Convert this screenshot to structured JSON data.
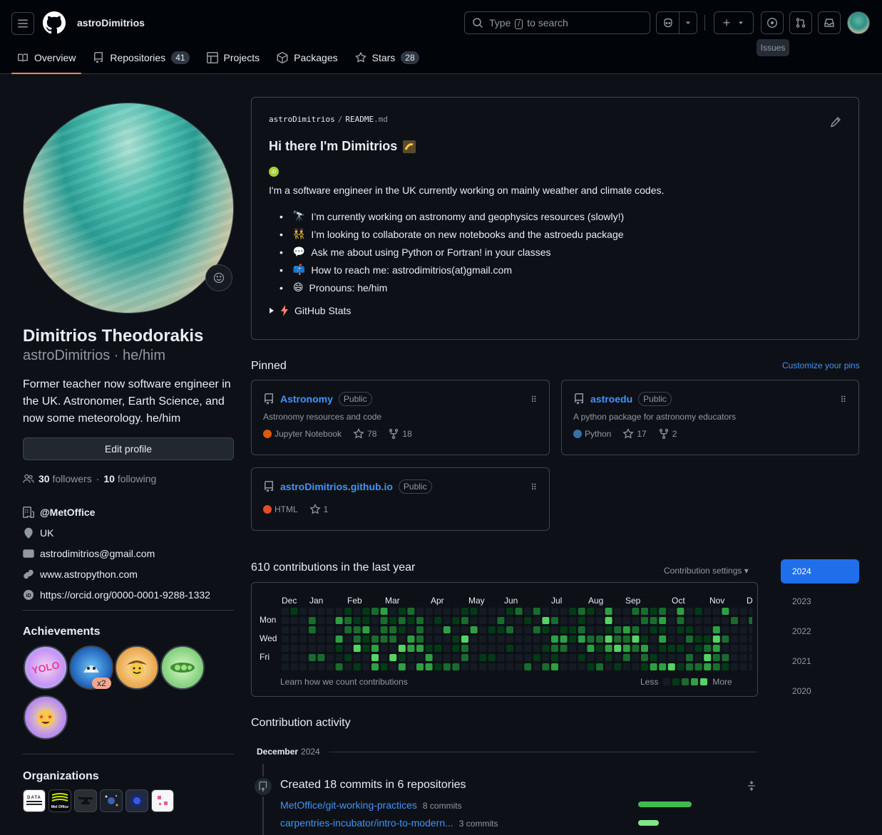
{
  "header": {
    "username": "astroDimitrios",
    "search_prefix": "Type",
    "search_key": "/",
    "search_suffix": "to search",
    "tooltip": "Issues"
  },
  "tabs": [
    {
      "label": "Overview",
      "icon": "book-icon",
      "active": true
    },
    {
      "label": "Repositories",
      "icon": "repo-icon",
      "count": "41"
    },
    {
      "label": "Projects",
      "icon": "table-icon"
    },
    {
      "label": "Packages",
      "icon": "package-icon"
    },
    {
      "label": "Stars",
      "icon": "star-icon",
      "count": "28"
    }
  ],
  "profile": {
    "full_name": "Dimitrios Theodorakis",
    "login_line": "astroDimitrios · he/him",
    "bio": "Former teacher now software engineer in the UK. Astronomer, Earth Science, and now some meteorology. he/him",
    "edit_label": "Edit profile",
    "followers": "30",
    "followers_label": "followers",
    "sep": "·",
    "following": "10",
    "following_label": "following",
    "org": "@MetOffice",
    "location": "UK",
    "email": "astrodimitrios@gmail.com",
    "website": "www.astropython.com",
    "orcid": "https://orcid.org/0000-0001-9288-1332",
    "achievements_title": "Achievements",
    "achievement_multiplier": "x2",
    "organizations_title": "Organizations"
  },
  "readme": {
    "owner": "astroDimitrios",
    "slash": "/",
    "file": "README",
    "ext": ".md",
    "heading": "Hi there I'm Dimitrios",
    "intro": "I'm a software engineer in the UK currently working on mainly weather and climate codes.",
    "items": [
      {
        "emoji": "🔭",
        "text": "I’m currently working on astronomy and geophysics resources (slowly!)"
      },
      {
        "emoji": "👯",
        "text": "I’m looking to collaborate on new notebooks and the astroedu package"
      },
      {
        "emoji": "💬",
        "text": "Ask me about using Python or Fortran! in your classes"
      },
      {
        "emoji": "📫",
        "text": "How to reach me: astrodimitrios(at)gmail.com"
      },
      {
        "emoji": "😄",
        "text": "Pronouns: he/him"
      }
    ],
    "details": "GitHub Stats"
  },
  "pinned": {
    "title": "Pinned",
    "customize": "Customize your pins",
    "repos": [
      {
        "name": "Astronomy",
        "visibility": "Public",
        "desc": "Astronomy resources and code",
        "lang": "Jupyter Notebook",
        "lang_color": "#DA5B0B",
        "stars": "78",
        "forks": "18"
      },
      {
        "name": "astroedu",
        "visibility": "Public",
        "desc": "A python package for astronomy educators",
        "lang": "Python",
        "lang_color": "#3572A5",
        "stars": "17",
        "forks": "2"
      },
      {
        "name": "astroDimitrios.github.io",
        "visibility": "Public",
        "desc": "",
        "lang": "HTML",
        "lang_color": "#e34c26",
        "stars": "1",
        "forks": ""
      }
    ]
  },
  "contributions": {
    "title": "610 contributions in the last year",
    "settings": "Contribution settings",
    "months": [
      "Dec",
      "Jan",
      "Feb",
      "Mar",
      "Apr",
      "May",
      "Jun",
      "Jul",
      "Aug",
      "Sep",
      "Oct",
      "Nov",
      "D"
    ],
    "days": [
      "Mon",
      "Wed",
      "Fri"
    ],
    "learn": "Learn how we count contributions",
    "less": "Less",
    "more": "More",
    "years": [
      "2024",
      "2023",
      "2022",
      "2021",
      "2020"
    ],
    "active_year": "2024"
  },
  "activity": {
    "title": "Contribution activity",
    "month": "December",
    "year": "2024",
    "summary": "Created 18 commits in 6 repositories",
    "rows": [
      {
        "repo": "MetOffice/git-working-practices",
        "count": "8 commits",
        "share": 0.44
      },
      {
        "repo": "carpentries-incubator/intro-to-modern...",
        "count": "3 commits",
        "share": 0.17
      }
    ]
  },
  "colors": {
    "accent_tab": "#f78166",
    "link": "#4493f8",
    "active_year": "#1f6feb",
    "levels": [
      "#151b23",
      "#033a16",
      "#196c2e",
      "#2ea043",
      "#56d364"
    ]
  }
}
